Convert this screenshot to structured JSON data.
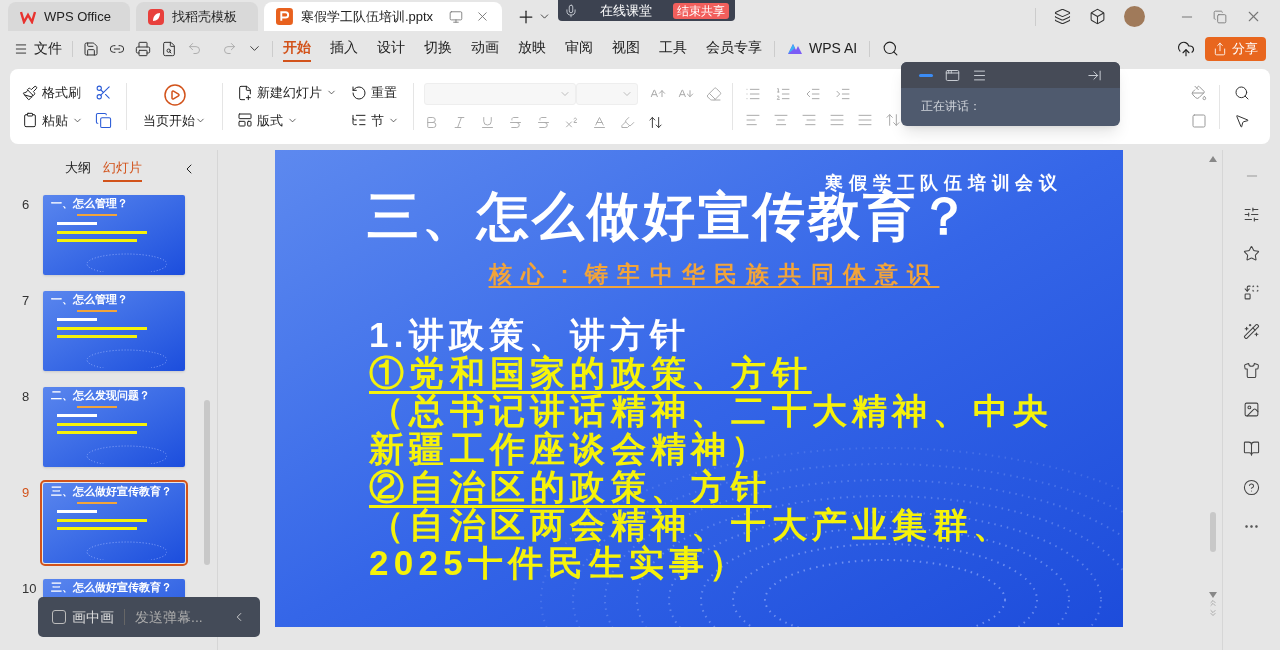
{
  "tabs": [
    {
      "label": "WPS Office",
      "kind": "home",
      "selected": false
    },
    {
      "label": "找稻壳模板",
      "kind": "template",
      "selected": false
    },
    {
      "label": "寒假学工队伍培训.pptx",
      "kind": "document",
      "selected": true
    }
  ],
  "meeting_bar": {
    "label": "在线课堂",
    "end_button": "结束共享"
  },
  "menu": {
    "file": "文件",
    "tabs": [
      {
        "label": "开始",
        "selected": true
      },
      {
        "label": "插入",
        "selected": false
      },
      {
        "label": "设计",
        "selected": false
      },
      {
        "label": "切换",
        "selected": false
      },
      {
        "label": "动画",
        "selected": false
      },
      {
        "label": "放映",
        "selected": false
      },
      {
        "label": "审阅",
        "selected": false
      },
      {
        "label": "视图",
        "selected": false
      },
      {
        "label": "工具",
        "selected": false
      },
      {
        "label": "会员专享",
        "selected": false
      }
    ],
    "ai": "WPS AI",
    "share": "分享"
  },
  "ribbon": {
    "format_painter": "格式刷",
    "paste": "粘贴",
    "play_current": "当页开始",
    "new_slide": "新建幻灯片",
    "layout": "版式",
    "reset": "重置",
    "section": "节"
  },
  "speaker_panel": {
    "label": "正在讲话："
  },
  "sidebar": {
    "tabs": [
      {
        "label": "大纲",
        "selected": false
      },
      {
        "label": "幻灯片",
        "selected": true
      }
    ],
    "slides": [
      {
        "number": "6",
        "title": "一、怎么管理？",
        "selected": false
      },
      {
        "number": "7",
        "title": "一、怎么管理？",
        "selected": false
      },
      {
        "number": "8",
        "title": "二、怎么发现问题？",
        "selected": false
      },
      {
        "number": "9",
        "title": "三、怎么做好宣传教育？",
        "selected": true
      },
      {
        "number": "10",
        "title": "三、怎么做好宣传教育？",
        "selected": false
      }
    ]
  },
  "overlay": {
    "pip_label": "画中画",
    "pip_checked": false,
    "danmaku_placeholder": "发送弹幕..."
  },
  "slide": {
    "header": "寒假学工队伍培训会议",
    "title": "三、怎么做好宣传教育？",
    "core": "核心：铸牢中华民族共同体意识",
    "lines": [
      {
        "text": "1.讲政策、讲方针",
        "kind": "heading"
      },
      {
        "text": "①党和国家的政策、方针",
        "kind": "underlined"
      },
      {
        "text": "（总书记讲话精神、二十大精神、中央新疆工作座谈会精神）",
        "kind": "plain"
      },
      {
        "text": "②自治区的政策、方针",
        "kind": "underlined"
      },
      {
        "text": "（自治区两会精神、十大产业集群、2025十件民生实事）",
        "kind": "plain"
      }
    ]
  }
}
